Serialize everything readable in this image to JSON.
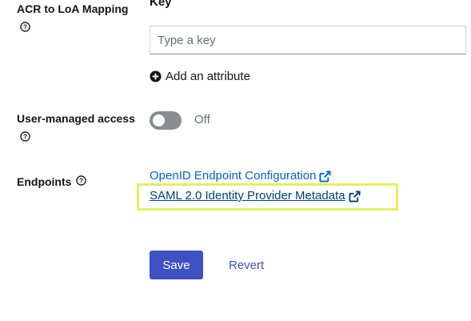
{
  "acr_section": {
    "label": "ACR to LoA Mapping",
    "key_heading": "Key",
    "key_placeholder": "Type a key",
    "add_attribute_label": "Add an attribute"
  },
  "user_managed_access": {
    "label": "User-managed access",
    "state_text": "Off",
    "enabled": false
  },
  "endpoints": {
    "label": "Endpoints",
    "links": [
      {
        "label": "OpenID Endpoint Configuration"
      },
      {
        "label": "SAML 2.0 Identity Provider Metadata"
      }
    ]
  },
  "actions": {
    "save_label": "Save",
    "revert_label": "Revert"
  },
  "colors": {
    "primary": "#3e50c4",
    "link": "#0066cc",
    "highlight": "#e6ef5a"
  },
  "icons": {
    "help": "help-circle-icon",
    "add": "plus-circle-icon",
    "external": "external-link-icon"
  }
}
